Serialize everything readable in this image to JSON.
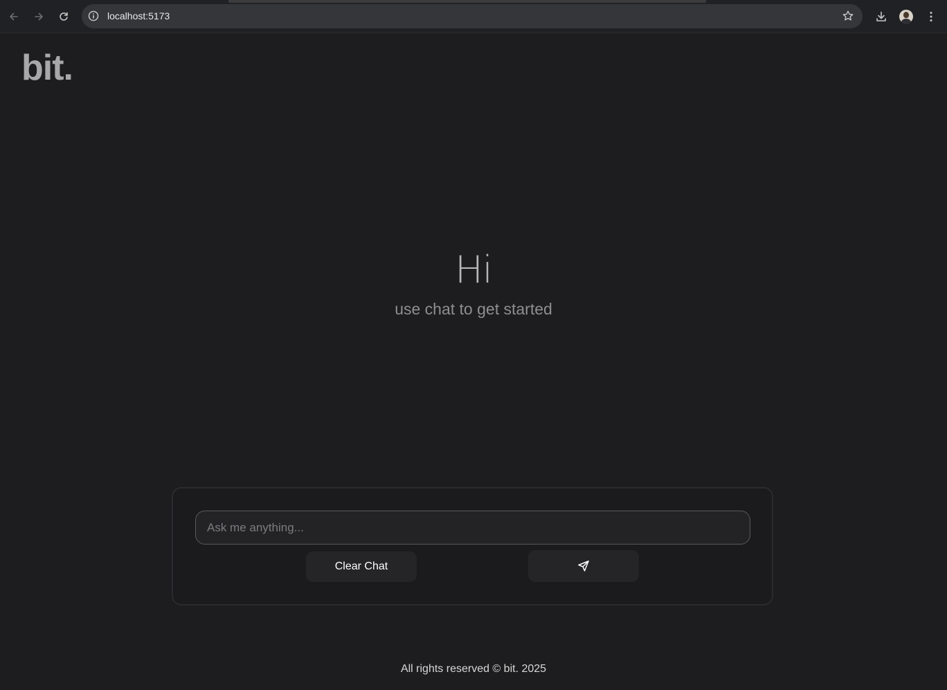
{
  "browser": {
    "url": "localhost:5173",
    "icons": [
      "back-arrow-icon",
      "forward-arrow-icon",
      "reload-icon",
      "info-icon",
      "star-icon",
      "download-icon",
      "profile-avatar",
      "more-vert-icon"
    ]
  },
  "page": {
    "logo": "bit.",
    "hero_title": "Hi",
    "hero_subtitle": "use chat to get started",
    "chat": {
      "placeholder": "Ask me anything...",
      "value": "",
      "clear_label": "Clear Chat",
      "send_icon": "send-icon"
    },
    "footer": "All rights reserved © bit. 2025"
  },
  "colors": {
    "background": "#1d1d1f",
    "panel_border": "#2b2b2e",
    "input_border": "#5a5a5e",
    "button_bg": "#252527"
  }
}
